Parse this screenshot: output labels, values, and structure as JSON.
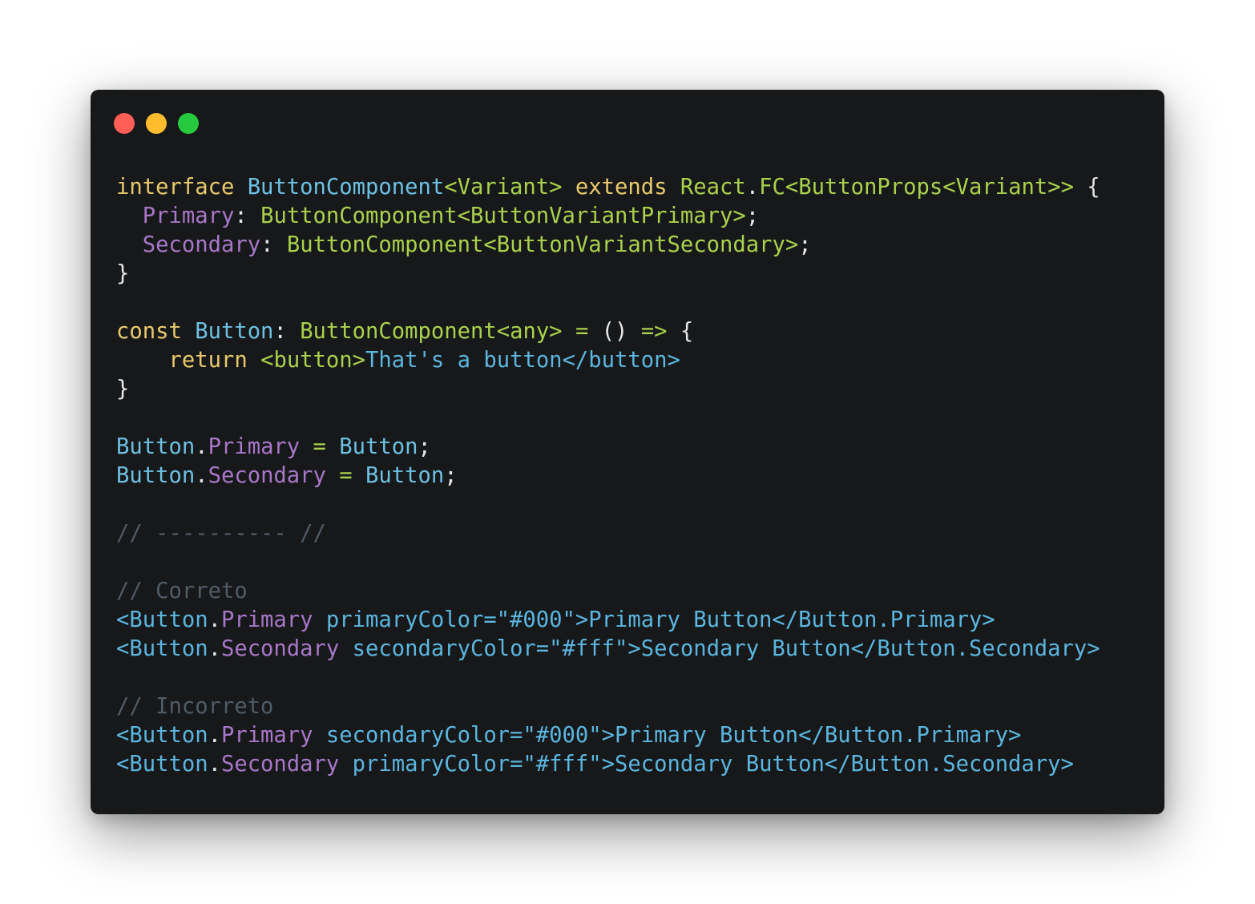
{
  "window": {
    "controls": [
      "close",
      "minimize",
      "zoom"
    ]
  },
  "code_lines": [
    [
      {
        "t": "interface ",
        "c": "kw"
      },
      {
        "t": "ButtonComponent",
        "c": "ty"
      },
      {
        "t": "<Variant>",
        "c": "tg"
      },
      {
        "t": " ",
        "c": "pl"
      },
      {
        "t": "extends",
        "c": "kw"
      },
      {
        "t": " ",
        "c": "pl"
      },
      {
        "t": "React",
        "c": "tg"
      },
      {
        "t": ".",
        "c": "pl"
      },
      {
        "t": "FC<ButtonProps<Variant>>",
        "c": "tg"
      },
      {
        "t": " {",
        "c": "pl"
      }
    ],
    [
      {
        "t": "  ",
        "c": "pl"
      },
      {
        "t": "Primary",
        "c": "pr"
      },
      {
        "t": ": ",
        "c": "pl"
      },
      {
        "t": "ButtonComponent<ButtonVariantPrimary>",
        "c": "tg"
      },
      {
        "t": ";",
        "c": "pl"
      }
    ],
    [
      {
        "t": "  ",
        "c": "pl"
      },
      {
        "t": "Secondary",
        "c": "pr"
      },
      {
        "t": ": ",
        "c": "pl"
      },
      {
        "t": "ButtonComponent<ButtonVariantSecondary>",
        "c": "tg"
      },
      {
        "t": ";",
        "c": "pl"
      }
    ],
    [
      {
        "t": "}",
        "c": "pl"
      }
    ],
    [],
    [
      {
        "t": "const ",
        "c": "kw"
      },
      {
        "t": "Button",
        "c": "ty"
      },
      {
        "t": ": ",
        "c": "pl"
      },
      {
        "t": "ButtonComponent<any>",
        "c": "tg"
      },
      {
        "t": " ",
        "c": "pl"
      },
      {
        "t": "=",
        "c": "op"
      },
      {
        "t": " () ",
        "c": "pl"
      },
      {
        "t": "=>",
        "c": "op"
      },
      {
        "t": " {",
        "c": "pl"
      }
    ],
    [
      {
        "t": "    ",
        "c": "pl"
      },
      {
        "t": "return",
        "c": "kw"
      },
      {
        "t": " ",
        "c": "pl"
      },
      {
        "t": "<button>",
        "c": "tg"
      },
      {
        "t": "That's a button",
        "c": "jsx"
      },
      {
        "t": "</button>",
        "c": "jsx"
      }
    ],
    [
      {
        "t": "}",
        "c": "pl"
      }
    ],
    [],
    [
      {
        "t": "Button",
        "c": "ty"
      },
      {
        "t": ".",
        "c": "pl"
      },
      {
        "t": "Primary",
        "c": "pr"
      },
      {
        "t": " ",
        "c": "pl"
      },
      {
        "t": "=",
        "c": "op"
      },
      {
        "t": " ",
        "c": "pl"
      },
      {
        "t": "Button",
        "c": "ty"
      },
      {
        "t": ";",
        "c": "pl"
      }
    ],
    [
      {
        "t": "Button",
        "c": "ty"
      },
      {
        "t": ".",
        "c": "pl"
      },
      {
        "t": "Secondary",
        "c": "pr"
      },
      {
        "t": " ",
        "c": "pl"
      },
      {
        "t": "=",
        "c": "op"
      },
      {
        "t": " ",
        "c": "pl"
      },
      {
        "t": "Button",
        "c": "ty"
      },
      {
        "t": ";",
        "c": "pl"
      }
    ],
    [],
    [
      {
        "t": "// ---------- //",
        "c": "cm"
      }
    ],
    [],
    [
      {
        "t": "// Correto",
        "c": "cm"
      }
    ],
    [
      {
        "t": "<Button",
        "c": "jsx"
      },
      {
        "t": ".",
        "c": "pl"
      },
      {
        "t": "Primary",
        "c": "pr"
      },
      {
        "t": " primaryColor=\"#000\">Primary Button</Button.Primary>",
        "c": "jsx"
      }
    ],
    [
      {
        "t": "<Button",
        "c": "jsx"
      },
      {
        "t": ".",
        "c": "pl"
      },
      {
        "t": "Secondary",
        "c": "pr"
      },
      {
        "t": " secondaryColor=\"#fff\">Secondary Button</Button.Secondary>",
        "c": "jsx"
      }
    ],
    [],
    [
      {
        "t": "// Incorreto",
        "c": "cm"
      }
    ],
    [
      {
        "t": "<Button",
        "c": "jsx"
      },
      {
        "t": ".",
        "c": "pl"
      },
      {
        "t": "Primary",
        "c": "pr"
      },
      {
        "t": " secondaryColor=\"#000\">Primary Button</Button.Primary>",
        "c": "jsx"
      }
    ],
    [
      {
        "t": "<Button",
        "c": "jsx"
      },
      {
        "t": ".",
        "c": "pl"
      },
      {
        "t": "Secondary",
        "c": "pr"
      },
      {
        "t": " primaryColor=\"#fff\">Secondary Button</Button.Secondary>",
        "c": "jsx"
      }
    ]
  ],
  "colors": {
    "background": "#17181a",
    "keyword": "#e8c96a",
    "type": "#6cc1e3",
    "generic": "#a9d14b",
    "property": "#a777c8",
    "comment": "#4f5b66",
    "jsx": "#5ab6df",
    "plain": "#e6e6e6"
  }
}
